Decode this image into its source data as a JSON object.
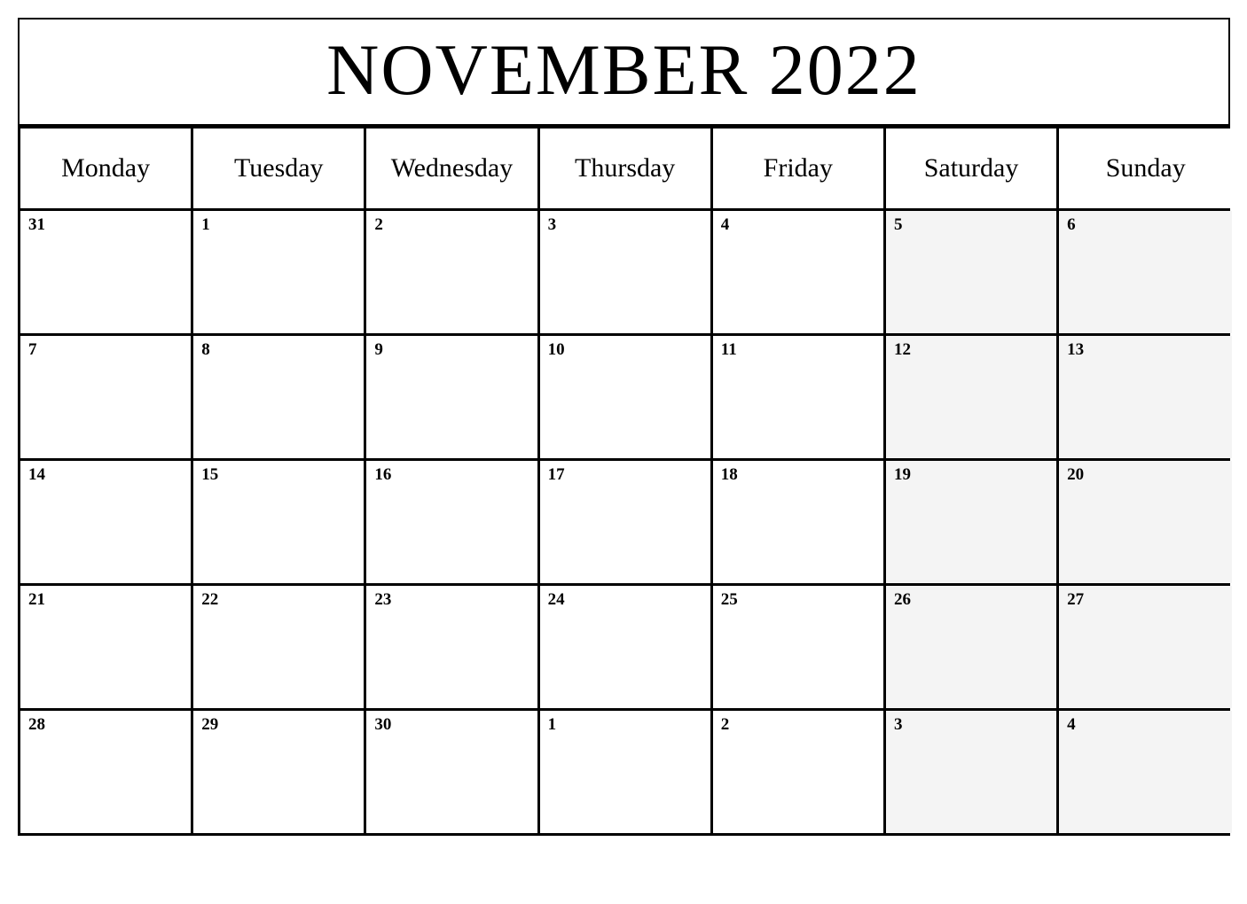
{
  "calendar": {
    "title": "NOVEMBER 2022",
    "month": "November",
    "year": "2022",
    "weekend_fill_color": "#f4f4f4",
    "border_color": "#000000",
    "day_headers": [
      {
        "label": "Monday",
        "key": "monday",
        "weekend": false
      },
      {
        "label": "Tuesday",
        "key": "tuesday",
        "weekend": false
      },
      {
        "label": "Wednesday",
        "key": "wednesday",
        "weekend": false
      },
      {
        "label": "Thursday",
        "key": "thursday",
        "weekend": false
      },
      {
        "label": "Friday",
        "key": "friday",
        "weekend": false
      },
      {
        "label": "Saturday",
        "key": "saturday",
        "weekend": true
      },
      {
        "label": "Sunday",
        "key": "sunday",
        "weekend": true
      }
    ],
    "weeks": [
      {
        "index": 0,
        "days": [
          {
            "num": "31",
            "weekend": false,
            "other_month": true
          },
          {
            "num": "1",
            "weekend": false,
            "other_month": false
          },
          {
            "num": "2",
            "weekend": false,
            "other_month": false
          },
          {
            "num": "3",
            "weekend": false,
            "other_month": false
          },
          {
            "num": "4",
            "weekend": false,
            "other_month": false
          },
          {
            "num": "5",
            "weekend": true,
            "other_month": false
          },
          {
            "num": "6",
            "weekend": true,
            "other_month": false
          }
        ]
      },
      {
        "index": 1,
        "days": [
          {
            "num": "7",
            "weekend": false,
            "other_month": false
          },
          {
            "num": "8",
            "weekend": false,
            "other_month": false
          },
          {
            "num": "9",
            "weekend": false,
            "other_month": false
          },
          {
            "num": "10",
            "weekend": false,
            "other_month": false
          },
          {
            "num": "11",
            "weekend": false,
            "other_month": false
          },
          {
            "num": "12",
            "weekend": true,
            "other_month": false
          },
          {
            "num": "13",
            "weekend": true,
            "other_month": false
          }
        ]
      },
      {
        "index": 2,
        "days": [
          {
            "num": "14",
            "weekend": false,
            "other_month": false
          },
          {
            "num": "15",
            "weekend": false,
            "other_month": false
          },
          {
            "num": "16",
            "weekend": false,
            "other_month": false
          },
          {
            "num": "17",
            "weekend": false,
            "other_month": false
          },
          {
            "num": "18",
            "weekend": false,
            "other_month": false
          },
          {
            "num": "19",
            "weekend": true,
            "other_month": false
          },
          {
            "num": "20",
            "weekend": true,
            "other_month": false
          }
        ]
      },
      {
        "index": 3,
        "days": [
          {
            "num": "21",
            "weekend": false,
            "other_month": false
          },
          {
            "num": "22",
            "weekend": false,
            "other_month": false
          },
          {
            "num": "23",
            "weekend": false,
            "other_month": false
          },
          {
            "num": "24",
            "weekend": false,
            "other_month": false
          },
          {
            "num": "25",
            "weekend": false,
            "other_month": false
          },
          {
            "num": "26",
            "weekend": true,
            "other_month": false
          },
          {
            "num": "27",
            "weekend": true,
            "other_month": false
          }
        ]
      },
      {
        "index": 4,
        "days": [
          {
            "num": "28",
            "weekend": false,
            "other_month": false
          },
          {
            "num": "29",
            "weekend": false,
            "other_month": false
          },
          {
            "num": "30",
            "weekend": false,
            "other_month": false
          },
          {
            "num": "1",
            "weekend": false,
            "other_month": true
          },
          {
            "num": "2",
            "weekend": false,
            "other_month": true
          },
          {
            "num": "3",
            "weekend": true,
            "other_month": true
          },
          {
            "num": "4",
            "weekend": true,
            "other_month": true
          }
        ]
      }
    ]
  }
}
